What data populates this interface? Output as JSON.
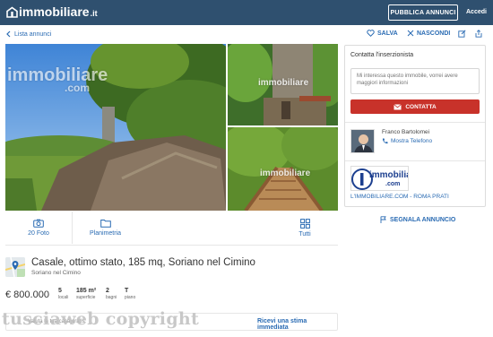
{
  "header": {
    "logo_text": "immobiliare",
    "logo_tld": ".it",
    "publish_label": "PUBBLICA ANNUNCI",
    "login_label": "Accedi",
    "brand_color": "#2f506f"
  },
  "subnav": {
    "back_label": "Lista annunci",
    "save_label": "SALVA",
    "hide_label": "NASCONDI"
  },
  "gallery": {
    "watermark_main": "immobiliare",
    "watermark_main_sub": ".com",
    "watermark_small": "immobiliare",
    "watermark_small_sub": ".com",
    "photos_label": "20 Foto",
    "plan_label": "Planimetria",
    "all_label": "Tutti"
  },
  "listing": {
    "title": "Casale, ottimo stato, 185 mq, Soriano nel Cimino",
    "location": "Soriano nel Cimino",
    "price": "€ 800.000",
    "features": [
      {
        "value": "5",
        "label": "locali"
      },
      {
        "value": "185 m²",
        "label": "superficie"
      },
      {
        "value": "2",
        "label": "bagni"
      },
      {
        "value": "T",
        "label": "piano"
      }
    ],
    "estimate_left": "Valuta la tua casa gratis",
    "estimate_link": "Ricevi una stima immediata",
    "copyright": "tusciaweb copyright"
  },
  "contact": {
    "title": "Contatta l'inserzionista",
    "message_placeholder": "Mi interessa questo immobile, vorrei avere maggiori informazioni",
    "contact_label": "CONTATTA",
    "agent_name": "Franco Bartolomei",
    "phone_label": "Mostra Telefono",
    "agency_logo_text": "immobiliare",
    "agency_logo_sub": ".com",
    "agency_name": "L'IMMOBILIARE.COM - ROMA PRATI",
    "report_label": "SEGNALA ANNUNCIO",
    "accent_color": "#c8322a"
  }
}
